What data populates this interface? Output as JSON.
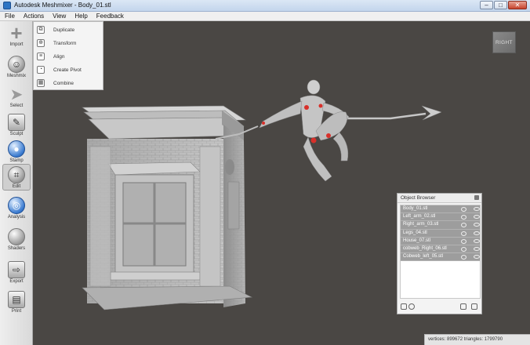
{
  "window": {
    "title": "Autodesk Meshmixer - Body_01.stl",
    "minimize": "–",
    "maximize": "□",
    "close": "✕"
  },
  "menu": [
    "File",
    "Actions",
    "View",
    "Help",
    "Feedback"
  ],
  "tools": [
    {
      "label": "Import",
      "icon": "plus-icon"
    },
    {
      "label": "Meshmix",
      "icon": "meshmix-icon"
    },
    {
      "label": "Select",
      "icon": "select-arrow-icon"
    },
    {
      "label": "Sculpt",
      "icon": "brush-icon"
    },
    {
      "label": "Stamp",
      "icon": "stamp-icon"
    },
    {
      "label": "Edit",
      "icon": "edit-icon"
    },
    {
      "label": "Analysis",
      "icon": "analysis-icon"
    },
    {
      "label": "Shaders",
      "icon": "shader-sphere-icon"
    },
    {
      "label": "Export",
      "icon": "export-icon"
    },
    {
      "label": "Print",
      "icon": "print-icon"
    }
  ],
  "edit_menu": [
    {
      "label": "Duplicate",
      "icon": "duplicate-icon"
    },
    {
      "label": "Transform",
      "icon": "transform-icon"
    },
    {
      "label": "Align",
      "icon": "align-icon"
    },
    {
      "label": "Create Pivot",
      "icon": "pivot-icon"
    },
    {
      "label": "Combine",
      "icon": "combine-icon"
    }
  ],
  "view_cube": {
    "face": "RIGHT"
  },
  "object_browser": {
    "title": "Object Browser",
    "objects": [
      "Body_01.stl",
      "Left_arm_02.stl",
      "Right_arm_03.stl",
      "Legs_04.stl",
      "House_07.stl",
      "cobweb_Right_06.stl",
      "Cobweb_left_05.stl"
    ]
  },
  "status": {
    "text": "vertices: 899672 triangles: 1799790"
  },
  "colors": {
    "viewport": "#4a4744",
    "model": "#c9c9c9",
    "highlight": "#d8302a"
  }
}
